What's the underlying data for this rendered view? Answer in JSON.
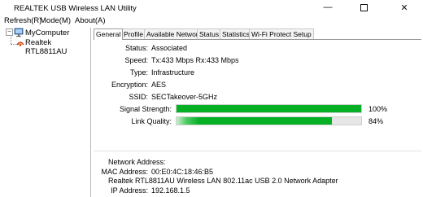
{
  "window": {
    "title": "REALTEK USB Wireless LAN Utility",
    "minimize": "—",
    "close": "✕"
  },
  "menu": [
    "Refresh(R)",
    "Mode(M)",
    "About(A)"
  ],
  "tree": {
    "root": "MyComputer",
    "expander": "−",
    "adapter": "Realtek RTL8811AU"
  },
  "tabs": [
    "General",
    "Profile",
    "Available Network",
    "Status",
    "Statistics",
    "Wi-Fi Protect Setup"
  ],
  "general": {
    "status_label": "Status:",
    "status_value": "Associated",
    "speed_label": "Speed:",
    "speed_value": "Tx:433 Mbps Rx:433 Mbps",
    "type_label": "Type:",
    "type_value": "Infrastructure",
    "encryption_label": "Encryption:",
    "encryption_value": "AES",
    "ssid_label": "SSID:",
    "ssid_value": "SECTakeover-5GHz",
    "signal_label": "Signal Strength:",
    "signal_percent": 100,
    "signal_text": "100%",
    "quality_label": "Link Quality:",
    "quality_percent": 84,
    "quality_text": "84%"
  },
  "network": {
    "heading": "Network Address:",
    "mac_label": "MAC Address:",
    "mac_value": "00:E0:4C:18:46:B5",
    "adapter_name": "Realtek RTL8811AU Wireless LAN 802.11ac USB 2.0 Network Adapter",
    "ip_label": "IP Address:",
    "ip_value": "192.168.1.5"
  },
  "colors": {
    "bar_green": "#06b025",
    "bar_track": "#e6e6e6"
  }
}
